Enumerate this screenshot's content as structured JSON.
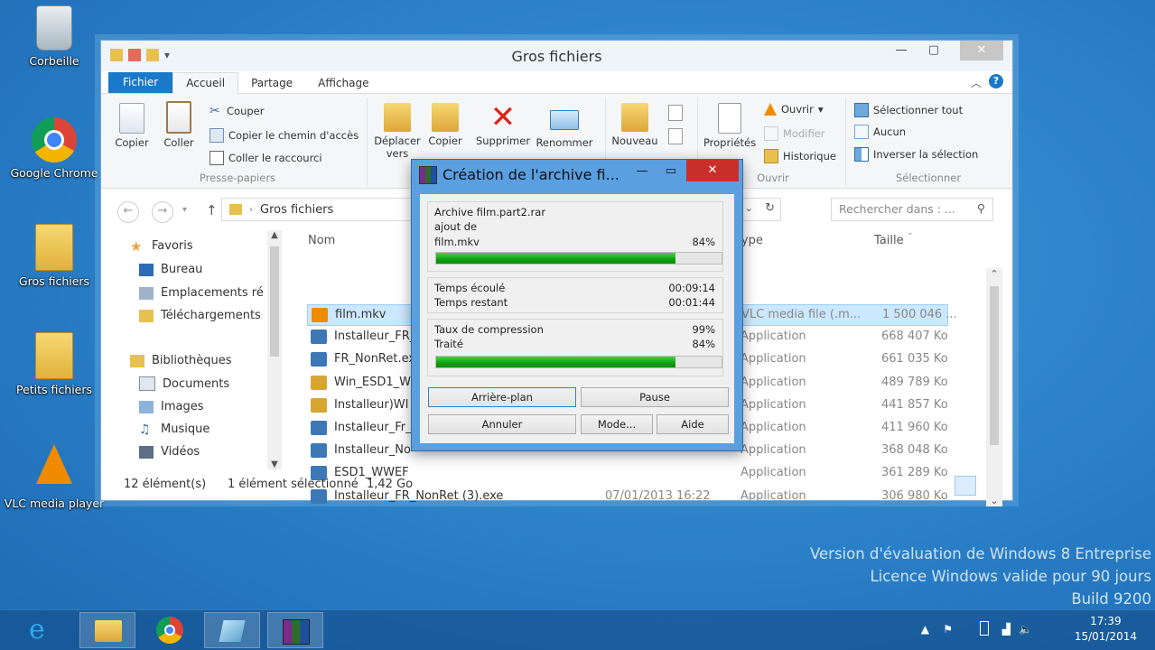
{
  "desktop_icons": [
    {
      "label": "Corbeille"
    },
    {
      "label": "Google Chrome"
    },
    {
      "label": "Gros fichiers"
    },
    {
      "label": "Petits fichiers"
    },
    {
      "label": "VLC media player"
    }
  ],
  "explorer": {
    "title": "Gros fichiers",
    "tabs": {
      "file": "Fichier",
      "home": "Accueil",
      "share": "Partage",
      "view": "Affichage"
    },
    "ribbon": {
      "copy": "Copier",
      "paste": "Coller",
      "cut": "Couper",
      "copy_path": "Copier le chemin d'accès",
      "paste_shortcut": "Coller le raccourci",
      "clipboard_group": "Presse-papiers",
      "move_to": "Déplacer vers",
      "copy_to": "Copier",
      "delete": "Supprimer",
      "rename": "Renommer",
      "new_folder": "Nouveau dossier",
      "properties": "Propriétés",
      "open": "Ouvrir",
      "edit": "Modifier",
      "history": "Historique",
      "open_group": "Ouvrir",
      "select_all": "Sélectionner tout",
      "select_none": "Aucun",
      "invert_selection": "Inverser la sélection",
      "select_group": "Sélectionner"
    },
    "address": {
      "path": "Gros fichiers",
      "search_placeholder": "Rechercher dans : ..."
    },
    "nav": {
      "favorites": "Favoris",
      "desktop": "Bureau",
      "recent": "Emplacements ré",
      "downloads": "Téléchargements",
      "libraries": "Bibliothèques",
      "documents": "Documents",
      "images": "Images",
      "music": "Musique",
      "videos": "Vidéos"
    },
    "columns": {
      "name": "Nom",
      "type": "Type",
      "size": "Taille"
    },
    "files": [
      {
        "name": "film.mkv",
        "date": "",
        "type": "VLC media file (.m...",
        "size": "1 500 046 ..."
      },
      {
        "name": "Installeur_FR_",
        "date": "",
        "type": "Application",
        "size": "668 407 Ko"
      },
      {
        "name": "FR_NonRet.ex",
        "date": "",
        "type": "Application",
        "size": "661 035 Ko"
      },
      {
        "name": "Win_ESD1_W",
        "date": "",
        "type": "Application",
        "size": "489 789 Ko"
      },
      {
        "name": "Installeur)WI",
        "date": "",
        "type": "Application",
        "size": "441 857 Ko"
      },
      {
        "name": "Installeur_Fr_",
        "date": "",
        "type": "Application",
        "size": "411 960 Ko"
      },
      {
        "name": "Installeur_No",
        "date": "",
        "type": "Application",
        "size": "368 048 Ko"
      },
      {
        "name": "ESD1_WWEF",
        "date": "",
        "type": "Application",
        "size": "361 289 Ko"
      },
      {
        "name": "Installeur_FR_NonRet (3).exe",
        "date": "07/01/2013 16:22",
        "type": "Application",
        "size": "306 980 Ko"
      }
    ],
    "status": {
      "count": "12 élément(s)",
      "selected": "1 élément sélectionné",
      "size": "1,42 Go"
    }
  },
  "dialog": {
    "title": "Création de l'archive fi...",
    "archive": "Archive film.part2.rar",
    "adding": "ajout de",
    "file": "film.mkv",
    "file_percent": "84%",
    "file_progress": 0.84,
    "elapsed_label": "Temps écoulé",
    "elapsed": "00:09:14",
    "remaining_label": "Temps restant",
    "remaining": "00:01:44",
    "ratio_label": "Taux de compression",
    "ratio": "99%",
    "processed_label": "Traité",
    "processed": "84%",
    "total_progress": 0.84,
    "buttons": {
      "background": "Arrière-plan",
      "pause": "Pause",
      "cancel": "Annuler",
      "mode": "Mode...",
      "help": "Aide"
    }
  },
  "watermark": {
    "line1": "Version d'évaluation de Windows 8 Entreprise",
    "line2": "Licence Windows valide pour 90 jours",
    "line3": "Build 9200"
  },
  "taskbar": {
    "time": "17:39",
    "date": "15/01/2014"
  },
  "colors": {
    "accent": "#1979ca",
    "progress": "#0fa00f",
    "dialog_frame": "#5a9fe0",
    "close": "#c9302c"
  }
}
